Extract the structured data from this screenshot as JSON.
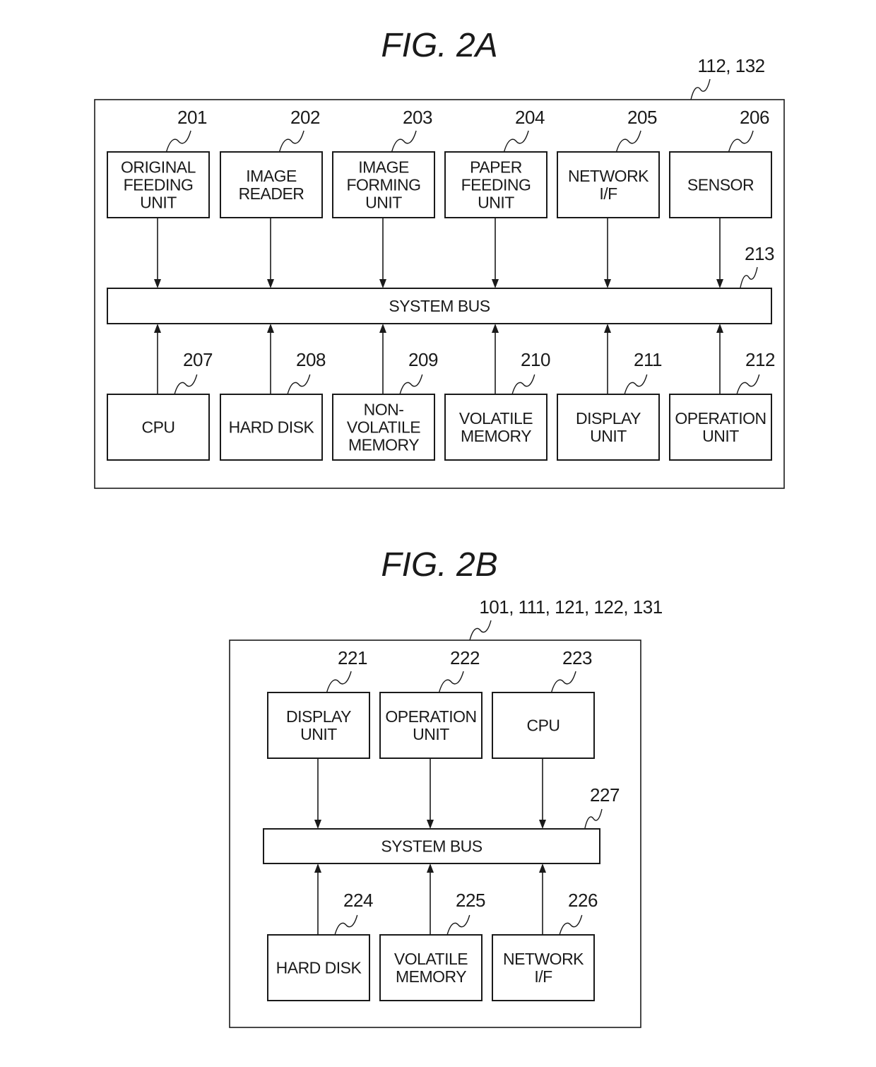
{
  "figures": [
    {
      "title": "FIG.  2A",
      "ref": "112, 132",
      "bus": {
        "label": "SYSTEM BUS",
        "ref": "213"
      },
      "top_units": [
        {
          "ref": "201",
          "lines": [
            "ORIGINAL",
            "FEEDING",
            "UNIT"
          ]
        },
        {
          "ref": "202",
          "lines": [
            "IMAGE",
            "READER"
          ]
        },
        {
          "ref": "203",
          "lines": [
            "IMAGE",
            "FORMING",
            "UNIT"
          ]
        },
        {
          "ref": "204",
          "lines": [
            "PAPER",
            "FEEDING",
            "UNIT"
          ]
        },
        {
          "ref": "205",
          "lines": [
            "NETWORK",
            "I/F"
          ]
        },
        {
          "ref": "206",
          "lines": [
            "SENSOR"
          ]
        }
      ],
      "bottom_units": [
        {
          "ref": "207",
          "lines": [
            "CPU"
          ]
        },
        {
          "ref": "208",
          "lines": [
            "HARD DISK"
          ]
        },
        {
          "ref": "209",
          "lines": [
            "NON-",
            "VOLATILE",
            "MEMORY"
          ]
        },
        {
          "ref": "210",
          "lines": [
            "VOLATILE",
            "MEMORY"
          ]
        },
        {
          "ref": "211",
          "lines": [
            "DISPLAY",
            "UNIT"
          ]
        },
        {
          "ref": "212",
          "lines": [
            "OPERATION",
            "UNIT"
          ]
        }
      ]
    },
    {
      "title": "FIG.  2B",
      "ref": "101, 111, 121, 122, 131",
      "bus": {
        "label": "SYSTEM BUS",
        "ref": "227"
      },
      "top_units": [
        {
          "ref": "221",
          "lines": [
            "DISPLAY",
            "UNIT"
          ]
        },
        {
          "ref": "222",
          "lines": [
            "OPERATION",
            "UNIT"
          ]
        },
        {
          "ref": "223",
          "lines": [
            "CPU"
          ]
        }
      ],
      "bottom_units": [
        {
          "ref": "224",
          "lines": [
            "HARD DISK"
          ]
        },
        {
          "ref": "225",
          "lines": [
            "VOLATILE",
            "MEMORY"
          ]
        },
        {
          "ref": "226",
          "lines": [
            "NETWORK",
            "I/F"
          ]
        }
      ]
    }
  ]
}
